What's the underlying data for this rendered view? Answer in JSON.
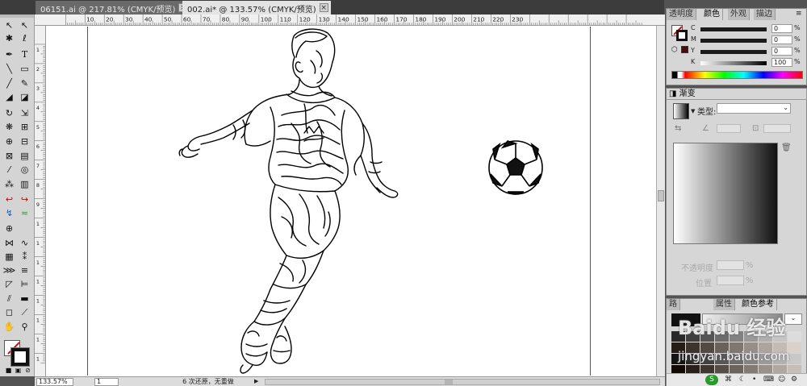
{
  "tabs": [
    {
      "label": "06151.ai @ 217.81% (CMYK/预览)",
      "active": false
    },
    {
      "label": "002.ai* @ 133.57% (CMYK/预览)",
      "active": true
    }
  ],
  "tab_close_glyph": "×",
  "ruler_top": [
    "10",
    "20",
    "30",
    "40",
    "50",
    "60",
    "70",
    "80",
    "90",
    "100",
    "110",
    "120",
    "130",
    "140",
    "150",
    "160",
    "170",
    "180",
    "190",
    "200",
    "210",
    "220",
    "230"
  ],
  "ruler_left": [
    "1",
    "2",
    "3",
    "4",
    "5",
    "6",
    "7",
    "8",
    "9",
    "1",
    "1",
    "1",
    "1",
    "1",
    "1",
    "1",
    "1",
    "1"
  ],
  "status": {
    "zoom": "133.57%",
    "page": "1",
    "history": "6 次还原，无重做"
  },
  "color_panel": {
    "tabs": [
      "透明度",
      "颜色",
      "外观",
      "描边"
    ],
    "channels": [
      {
        "label": "C",
        "value": "0"
      },
      {
        "label": "M",
        "value": "0"
      },
      {
        "label": "Y",
        "value": "0"
      },
      {
        "label": "K",
        "value": "100"
      }
    ],
    "percent": "%"
  },
  "gradient_panel": {
    "tab": "渐变",
    "type_label": "类型:",
    "opacity_label": "不透明度",
    "position_label": "位置",
    "percent": "%"
  },
  "bottom_panel": {
    "tabs": [
      "路",
      "属性",
      "颜色参考"
    ]
  },
  "watermark": {
    "brand": "Baidu 经验",
    "url": "jingyan.baidu.com"
  }
}
